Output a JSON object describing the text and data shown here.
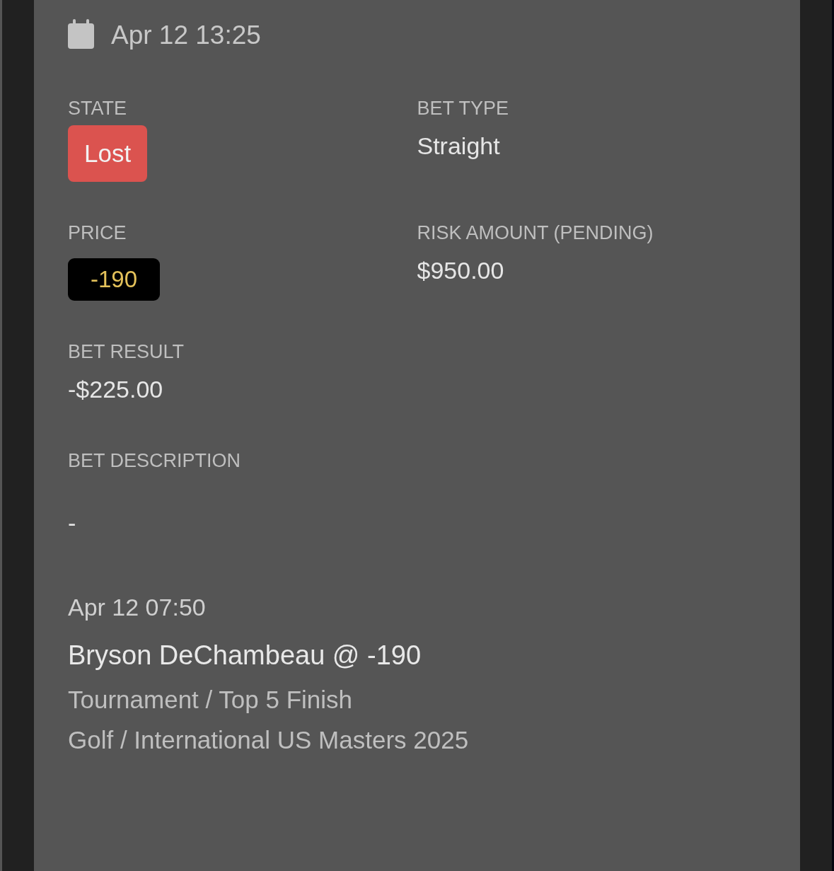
{
  "header": {
    "date": "Apr 12 13:25"
  },
  "fields": [
    {
      "label": "STATE",
      "kind": "status",
      "value": "Lost",
      "color": "#db534f"
    },
    {
      "label": "BET TYPE",
      "kind": "text",
      "value": "Straight"
    },
    {
      "label": "PRICE",
      "kind": "odds",
      "value": "-190"
    },
    {
      "label": "RISK AMOUNT (PENDING)",
      "kind": "text",
      "value": "$950.00"
    },
    {
      "label": "BET RESULT",
      "kind": "text",
      "value": "-$225.00"
    }
  ],
  "description": {
    "label": "BET DESCRIPTION",
    "value": "-"
  },
  "selection": {
    "date": "Apr 12 07:50",
    "title": "Bryson DeChambeau @ -190",
    "market": "Tournament / Top 5 Finish",
    "event": "Golf / International US Masters 2025"
  }
}
